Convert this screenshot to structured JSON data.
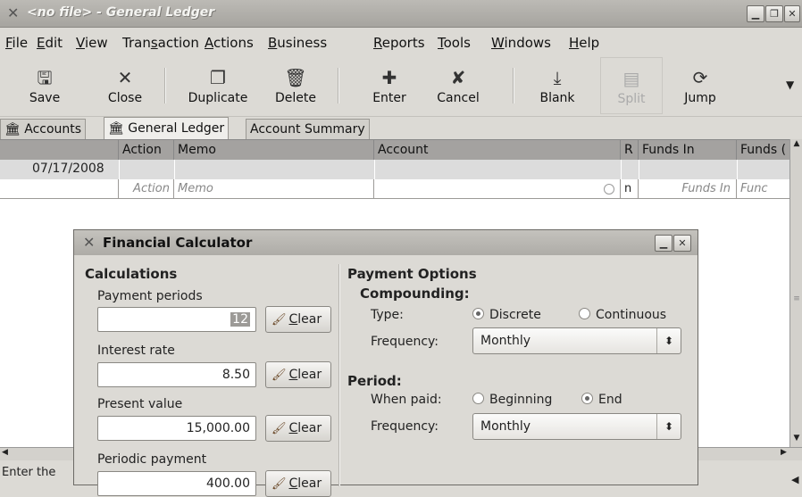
{
  "window": {
    "title": "<no file> - General Ledger"
  },
  "menu": [
    "File",
    "Edit",
    "View",
    "Transaction",
    "Actions",
    "Business",
    "Reports",
    "Tools",
    "Windows",
    "Help"
  ],
  "menu_mnemonics": [
    "F",
    "E",
    "V",
    "s",
    "A",
    "B",
    "R",
    "T",
    "W",
    "H"
  ],
  "toolbar": {
    "save": "Save",
    "close": "Close",
    "duplicate": "Duplicate",
    "delete": "Delete",
    "enter": "Enter",
    "cancel": "Cancel",
    "blank": "Blank",
    "split": "Split",
    "jump": "Jump"
  },
  "tabs": [
    "Accounts",
    "General Ledger",
    "Account Summary"
  ],
  "register": {
    "headers": {
      "action": "Action",
      "memo": "Memo",
      "account": "Account",
      "r": "R",
      "funds_in": "Funds In",
      "funds_out": "Funds ("
    },
    "row_date": "07/17/2008",
    "placeholders": {
      "action": "Action",
      "memo": "Memo",
      "r": "n",
      "funds_in": "Funds In",
      "funds_out": "Func"
    }
  },
  "status": {
    "text": "Enter the"
  },
  "dialog": {
    "title": "Financial Calculator",
    "calculations_heading": "Calculations",
    "payment_periods_label": "Payment periods",
    "payment_periods_value": "12",
    "interest_rate_label": "Interest rate",
    "interest_rate_value": "8.50",
    "present_value_label": "Present value",
    "present_value_value": "15,000.00",
    "periodic_payment_label": "Periodic payment",
    "periodic_payment_value": "400.00",
    "clear_label": "Clear",
    "payment_options_heading": "Payment Options",
    "compounding_heading": "Compounding:",
    "type_label": "Type:",
    "discrete_label": "Discrete",
    "continuous_label": "Continuous",
    "frequency_label": "Frequency:",
    "compounding_frequency": "Monthly",
    "period_heading": "Period:",
    "when_paid_label": "When paid:",
    "beginning_label": "Beginning",
    "end_label": "End",
    "period_frequency": "Monthly"
  }
}
